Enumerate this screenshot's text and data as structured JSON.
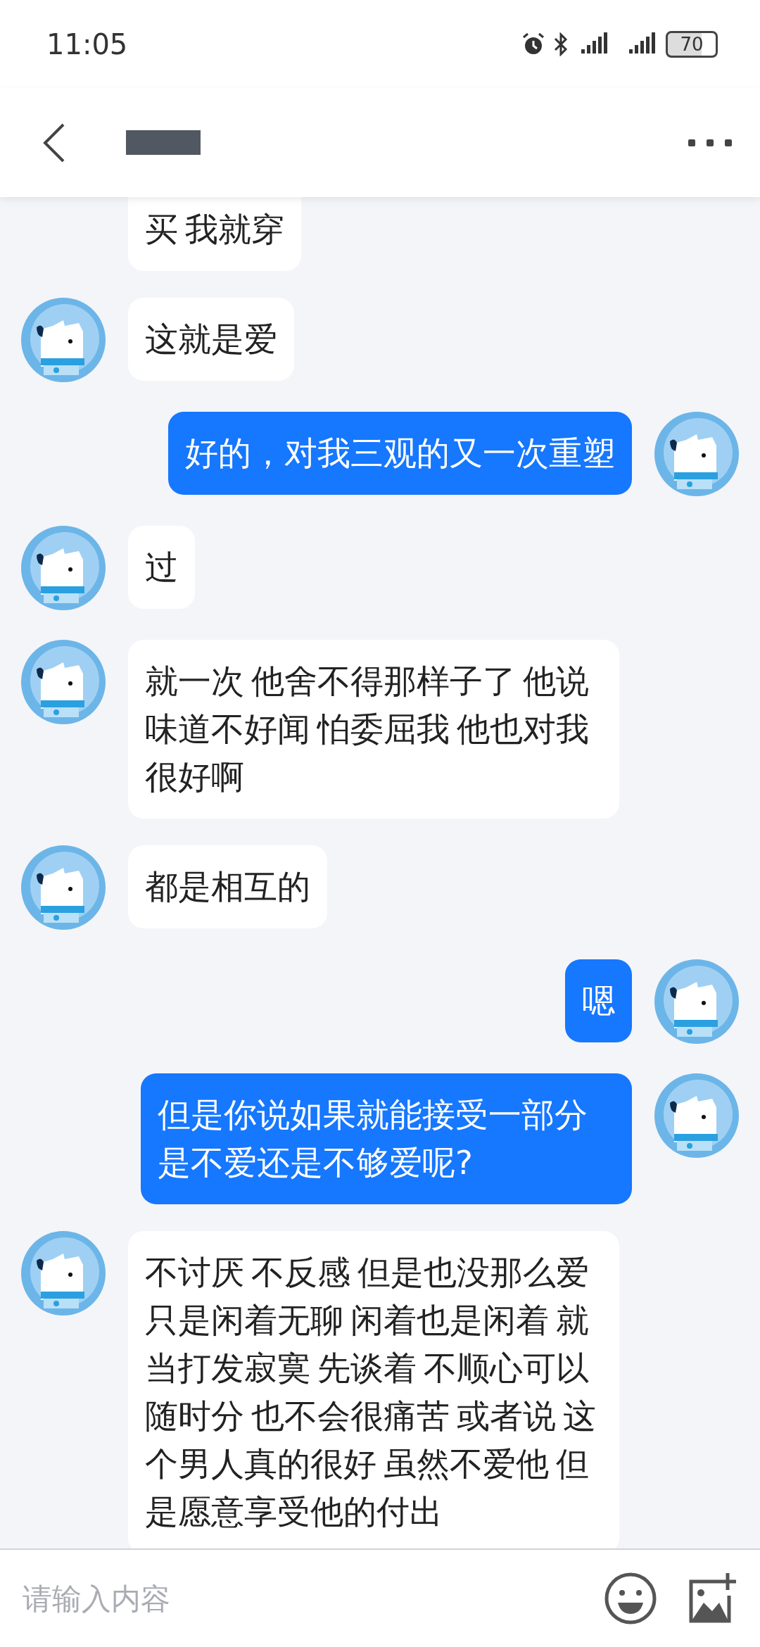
{
  "status_bar": {
    "time": "11:05",
    "battery": "70"
  },
  "header": {
    "name_redacted": true
  },
  "messages": [
    {
      "kind": "received",
      "avatar": false,
      "text": "买 我就穿"
    },
    {
      "kind": "received",
      "avatar": true,
      "text": "这就是爱"
    },
    {
      "kind": "sent",
      "avatar": true,
      "text": "好的，对我三观的又一次重塑"
    },
    {
      "kind": "received",
      "avatar": true,
      "text": "过"
    },
    {
      "kind": "received",
      "avatar": true,
      "text": "就一次 他舍不得那样子了 他说味道不好闻 怕委屈我 他也对我很好啊"
    },
    {
      "kind": "received",
      "avatar": true,
      "text": "都是相互的"
    },
    {
      "kind": "sent",
      "avatar": true,
      "text": "嗯"
    },
    {
      "kind": "sent",
      "avatar": true,
      "text": "但是你说如果就能接受一部分是不爱还是不够爱呢?"
    },
    {
      "kind": "received",
      "avatar": true,
      "text": "不讨厌 不反感 但是也没那么爱只是闲着无聊 闲着也是闲着 就当打发寂寞 先谈着 不顺心可以随时分 也不会很痛苦 或者说 这个男人真的很好 虽然不爱他 但是愿意享受他的付出"
    }
  ],
  "input": {
    "placeholder": "请输入内容"
  }
}
